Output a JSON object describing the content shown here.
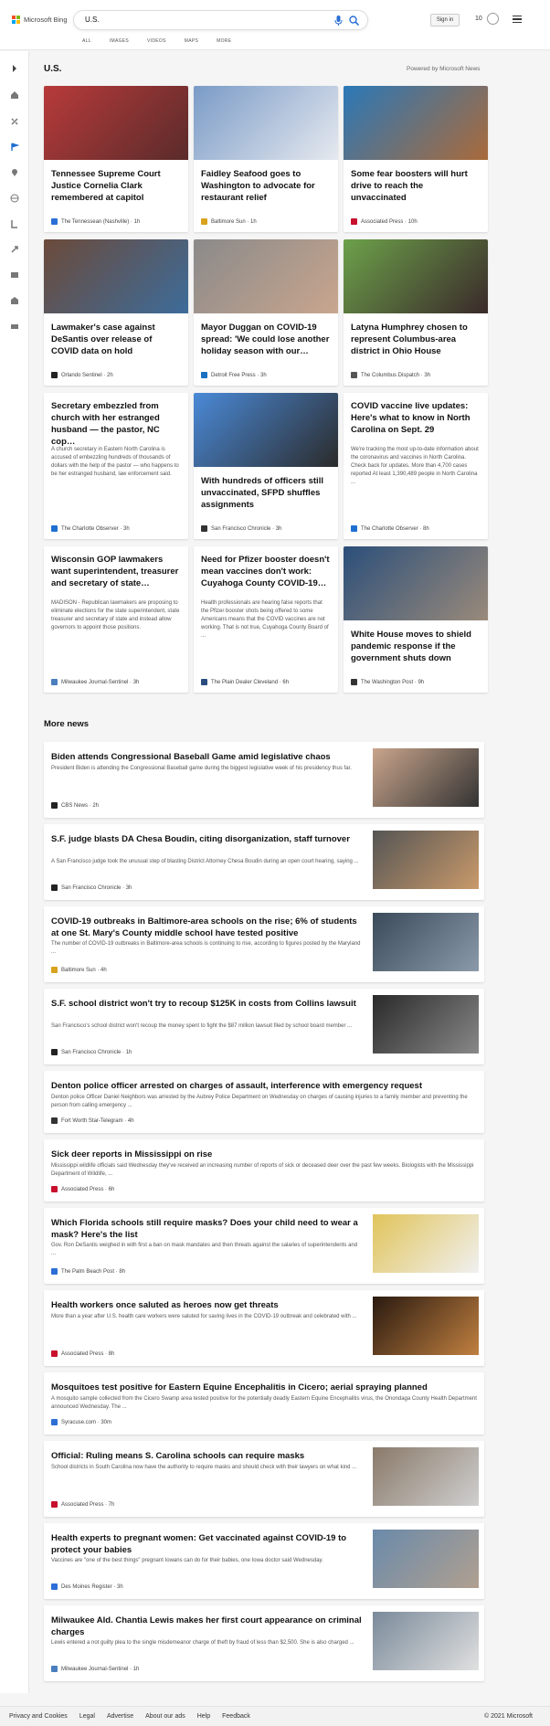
{
  "header": {
    "brand": "Microsoft Bing",
    "search_query": "U.S.",
    "tabs": [
      "ALL",
      "IMAGES",
      "VIDEOS",
      "MAPS",
      "MORE"
    ],
    "sign_in": "Sign in",
    "rewards_count": "10"
  },
  "sidebar": {
    "icons": [
      "collapse-arrow-icon",
      "home-icon",
      "discover-icon",
      "flag-icon",
      "location-icon",
      "world-icon",
      "tech-icon",
      "science-icon",
      "entertainment-icon",
      "business-icon",
      "money-icon"
    ]
  },
  "section": {
    "title": "U.S.",
    "powered_by": "Powered by Microsoft News"
  },
  "cards": [
    {
      "title": "Tennessee Supreme Court Justice Cornelia Clark remembered at capitol",
      "source": "The Tennessean (Nashville) · 1h",
      "snippet": ""
    },
    {
      "title": "Faidley Seafood goes to Washington to advocate for restaurant relief",
      "source": "Baltimore Sun · 1h",
      "snippet": ""
    },
    {
      "title": "Some fear boosters will hurt drive to reach the unvaccinated",
      "source": "Associated Press · 10h",
      "snippet": ""
    },
    {
      "title": "Lawmaker's case against DeSantis over release of COVID data on hold",
      "source": "Orlando Sentinel · 2h",
      "snippet": ""
    },
    {
      "title": "Mayor Duggan on COVID-19 spread: 'We could lose another holiday season with our…",
      "source": "Detroit Free Press · 3h",
      "snippet": ""
    },
    {
      "title": "Latyna Humphrey chosen to represent Columbus-area district in Ohio House",
      "source": "The Columbus Dispatch · 3h",
      "snippet": ""
    },
    {
      "title": "Secretary embezzled from church with her estranged husband — the pastor, NC cop…",
      "source": "The Charlotte Observer · 3h",
      "snippet": "A church secretary in Eastern North Carolina is accused of embezzling hundreds of thousands of dollars with the help of the pastor — who happens to be her estranged husband, law enforcement said."
    },
    {
      "title": "With hundreds of officers still unvaccinated, SFPD shuffles assignments",
      "source": "San Francisco Chronicle · 3h",
      "snippet": ""
    },
    {
      "title": "COVID vaccine live updates: Here's what to know in North Carolina on Sept. 29",
      "source": "The Charlotte Observer · 8h",
      "snippet": "We're tracking the most up-to-date information about the coronavirus and vaccines in North Carolina. Check back for updates. More than 4,700 cases reported At least 1,390,489 people in North Carolina ..."
    },
    {
      "title": "Wisconsin GOP lawmakers want superintendent, treasurer and secretary of state…",
      "source": "Milwaukee Journal-Sentinel · 3h",
      "snippet": "MADISON - Republican lawmakers are proposing to eliminate elections for the state superintendent, state treasurer and secretary of state and instead allow governors to appoint those positions."
    },
    {
      "title": "Need for Pfizer booster doesn't mean vaccines don't work: Cuyahoga County COVID-19…",
      "source": "The Plain Dealer Cleveland · 6h",
      "snippet": "Health professionals are hearing false reports that the Pfizer booster shots being offered to some Americans means that the COVID vaccines are not working. That is not true, Cuyahoga County Board of ..."
    },
    {
      "title": "White House moves to shield pandemic response if the government shuts down",
      "source": "The Washington Post · 9h",
      "snippet": ""
    }
  ],
  "more_news": {
    "title": "More news",
    "items": [
      {
        "title": "Biden attends Congressional Baseball Game amid legislative chaos",
        "snippet": "President Biden is attending the Congressional Baseball game during the biggest legislative week of his presidency thus far.",
        "source": "CBS News · 2h"
      },
      {
        "title": "S.F. judge blasts DA Chesa Boudin, citing disorganization, staff turnover",
        "snippet": "A San Francisco judge took the unusual step of blasting District Attorney Chesa Boudin during an open court hearing, saying ...",
        "source": "San Francisco Chronicle · 3h"
      },
      {
        "title": "COVID-19 outbreaks in Baltimore-area schools on the rise; 6% of students at one St. Mary's County middle school have tested positive",
        "snippet": "The number of COVID-19 outbreaks in Baltimore-area schools is continuing to rise, according to figures posted by the Maryland ...",
        "source": "Baltimore Sun · 4h"
      },
      {
        "title": "S.F. school district won't try to recoup $125K in costs from Collins lawsuit",
        "snippet": "San Francisco's school district won't recoup the money spent to fight the $87 million lawsuit filed by school board member ...",
        "source": "San Francisco Chronicle · 1h"
      },
      {
        "title": "Denton police officer arrested on charges of assault, interference with emergency request",
        "snippet": "Denton police Officer Daniel Neighbors was arrested by the Aubrey Police Department on Wednesday on charges of causing injuries to a family member and preventing the person from calling emergency ...",
        "source": "Fort Worth Star-Telegram · 4h"
      },
      {
        "title": "Sick deer reports in Mississippi on rise",
        "snippet": "Mississippi wildlife officials said Wednesday they've received an increasing number of reports of sick or deceased deer over the past few weeks. Biologists with the Mississippi Department of Wildlife, ...",
        "source": "Associated Press · 6h"
      },
      {
        "title": "Which Florida schools still require masks? Does your child need to wear a mask? Here's the list",
        "snippet": "Gov. Ron DeSantis weighed in with first a ban on mask mandates and then threats against the salaries of superintendents and ...",
        "source": "The Palm Beach Post · 8h"
      },
      {
        "title": "Health workers once saluted as heroes now get threats",
        "snippet": "More than a year after U.S. health care workers were saluted for saving lives in the COVID-19 outbreak and celebrated with ...",
        "source": "Associated Press · 8h"
      },
      {
        "title": "Mosquitoes test positive for Eastern Equine Encephalitis in Cicero; aerial spraying planned",
        "snippet": "A mosquito sample collected from the Cicero Swamp area tested positive for the potentially deadly Eastern Equine Encephalitis virus, the Onondaga County Health Department announced Wednesday. The ...",
        "source": "Syracuse.com · 30m"
      },
      {
        "title": "Official: Ruling means S. Carolina schools can require masks",
        "snippet": "School districts in South Carolina now have the authority to require masks and should check with their lawyers on what kind ...",
        "source": "Associated Press · 7h"
      },
      {
        "title": "Health experts to pregnant women: Get vaccinated against COVID-19 to protect your babies",
        "snippet": "Vaccines are \"one of the best things\" pregnant Iowans can do for their babies, one Iowa doctor said Wednesday.",
        "source": "Des Moines Register · 3h"
      },
      {
        "title": "Milwaukee Ald. Chantia Lewis makes her first court appearance on criminal charges",
        "snippet": "Lewis entered a not guilty plea to the single misdemeanor charge of theft by fraud of less than $2,500. She is also charged ...",
        "source": "Milwaukee Journal-Sentinel · 1h"
      }
    ]
  },
  "footer": {
    "links": [
      "Privacy and Cookies",
      "Legal",
      "Advertise",
      "About our ads",
      "Help",
      "Feedback"
    ],
    "copyright": "© 2021 Microsoft"
  }
}
